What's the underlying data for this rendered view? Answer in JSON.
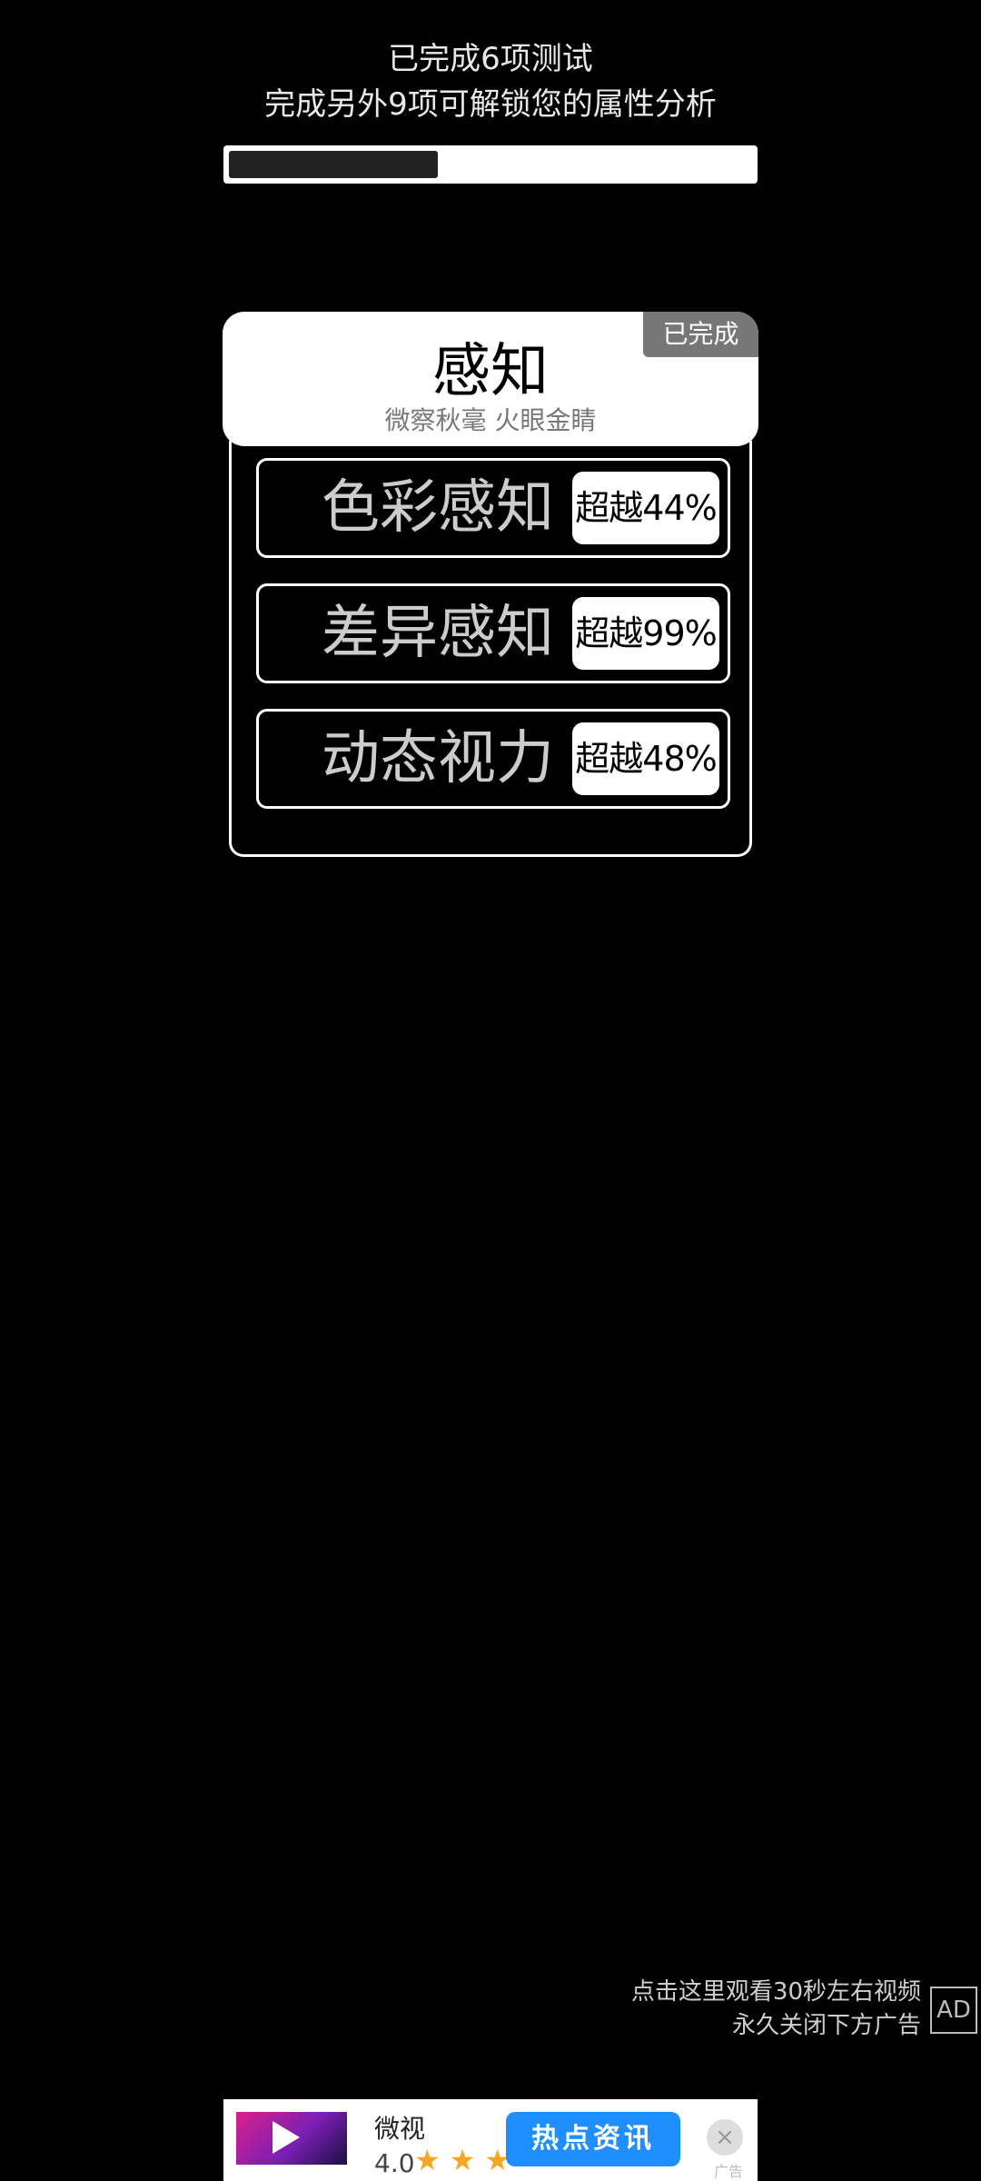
{
  "header": {
    "line1": "已完成6项测试",
    "line2": "完成另外9项可解锁您的属性分析"
  },
  "progress": {
    "completed": 6,
    "total": 15,
    "fraction": 0.4
  },
  "category": {
    "badge": "已完成",
    "title": "感知",
    "subtitle": "微察秋毫 火眼金睛"
  },
  "items": [
    {
      "label": "色彩感知",
      "score": "超越44%"
    },
    {
      "label": "差异感知",
      "score": "超越99%"
    },
    {
      "label": "动态视力",
      "score": "超越48%"
    }
  ],
  "ad_hint": {
    "line1": "点击这里观看30秒左右视频",
    "line2": "永久关闭下方广告",
    "icon": "AD"
  },
  "ad_banner": {
    "app_name": "微视",
    "rating": "4.0",
    "stars": "★★★",
    "cta": "热点资讯",
    "ad_label": "广告",
    "close_symbol": "×"
  },
  "colors": {
    "background": "#000000",
    "cta": "#1f8fff",
    "badge": "#777777"
  }
}
